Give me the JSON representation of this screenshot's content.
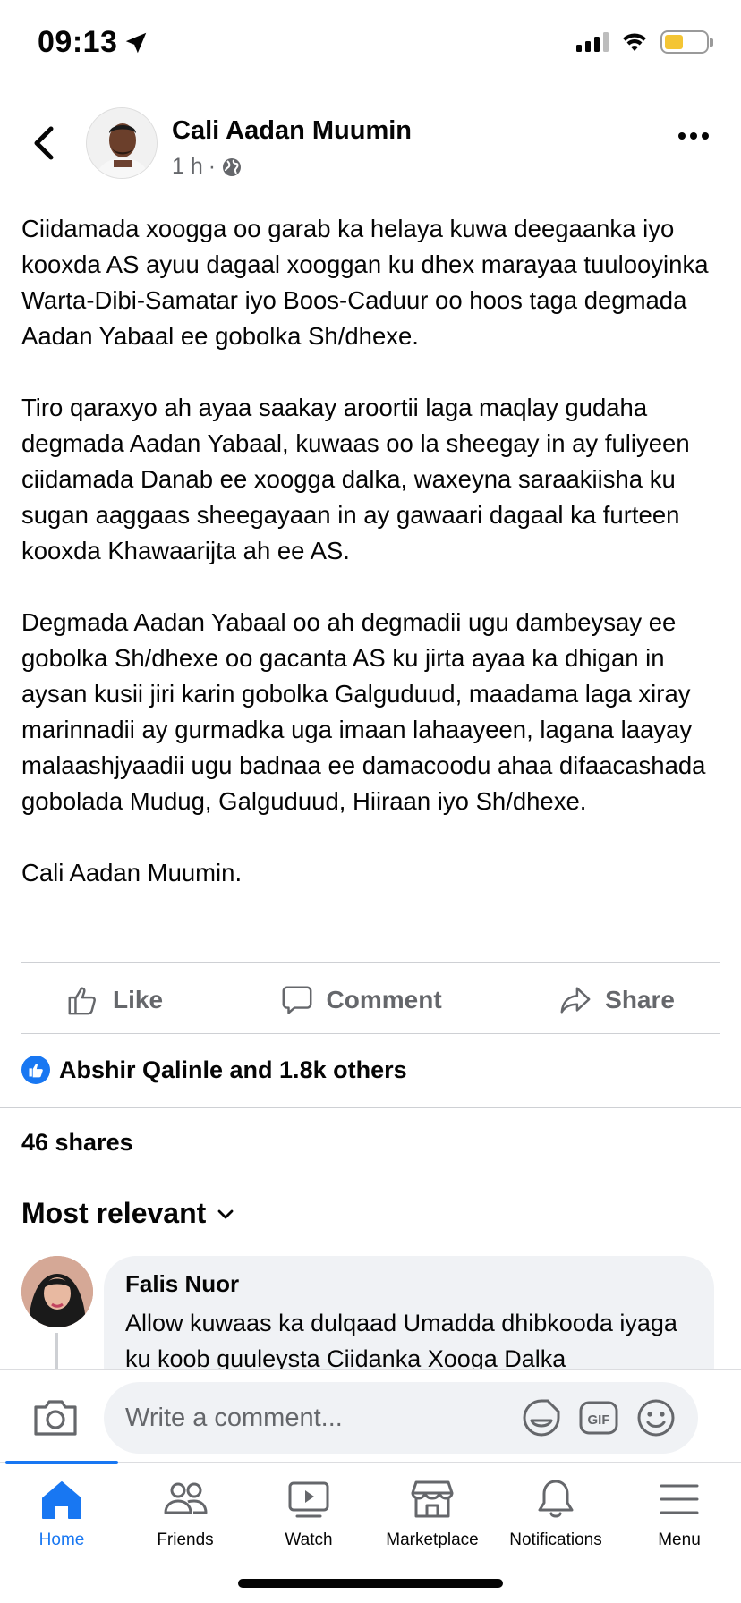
{
  "status_bar": {
    "time": "09:13",
    "battery_level": 0.45,
    "battery_color": "#f4c534"
  },
  "post": {
    "author": "Cali Aadan Muumin",
    "time": "1 h",
    "privacy_icon": "globe-icon",
    "paragraphs": [
      "Ciidamada xoogga oo garab ka helaya kuwa deegaanka iyo kooxda AS ayuu dagaal xooggan ku dhex marayaa tuulooyinka Warta-Dibi-Samatar iyo Boos-Caduur oo hoos taga degmada Aadan Yabaal ee gobolka Sh/dhexe.",
      "Tiro qaraxyo ah ayaa saakay aroortii laga maqlay gudaha degmada Aadan Yabaal, kuwaas oo la sheegay in ay fuliyeen ciidamada Danab ee xoogga dalka, waxeyna saraakiisha ku sugan aaggaas sheegayaan in ay gawaari dagaal ka furteen kooxda Khawaarijta ah ee AS.",
      "Degmada Aadan Yabaal oo ah degmadii ugu dambeysay ee gobolka Sh/dhexe oo gacanta AS ku jirta ayaa ka dhigan in aysan kusii jiri karin gobolka Galguduud, maadama laga xiray marinnadii ay gurmadka uga imaan lahaayeen, lagana laayay malaashjyaadii ugu badnaa ee damacoodu ahaa difaacashada gobolada Mudug, Galguduud, Hiiraan iyo Sh/dhexe.",
      "Cali Aadan Muumin."
    ]
  },
  "actions": {
    "like": "Like",
    "comment": "Comment",
    "share": "Share"
  },
  "reactions": {
    "summary": "Abshir Qalinle and 1.8k others"
  },
  "shares_text": "46 shares",
  "sort_label": "Most relevant",
  "comment": {
    "author": "Falis Nuor",
    "text": "Allow kuwaas ka dulqaad Umadda dhibkooda iyaga ku koob guuleysta Ciidanka Xooga Dalka"
  },
  "composer": {
    "placeholder": "Write a comment...",
    "gif_label": "GIF"
  },
  "nav": {
    "items": [
      {
        "label": "Home",
        "icon": "home-icon"
      },
      {
        "label": "Friends",
        "icon": "friends-icon"
      },
      {
        "label": "Watch",
        "icon": "watch-icon"
      },
      {
        "label": "Marketplace",
        "icon": "marketplace-icon"
      },
      {
        "label": "Notifications",
        "icon": "bell-icon"
      },
      {
        "label": "Menu",
        "icon": "menu-icon"
      }
    ],
    "active_color": "#1877f2"
  }
}
